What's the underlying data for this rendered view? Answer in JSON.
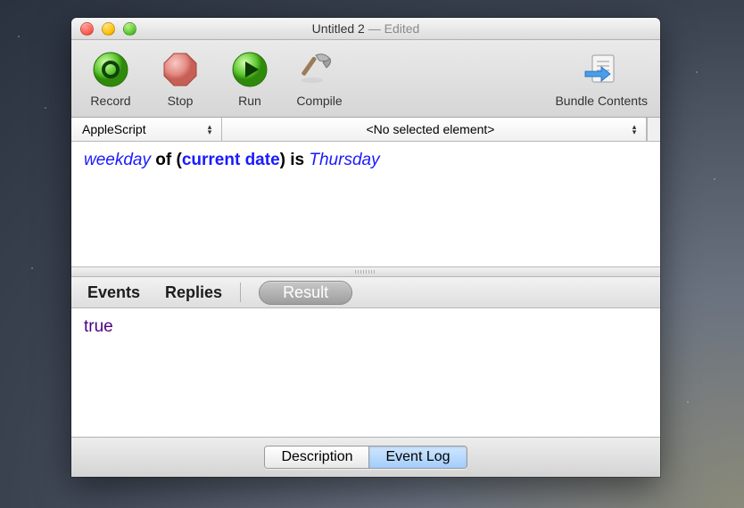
{
  "window": {
    "title_main": "Untitled 2",
    "title_suffix": " — Edited"
  },
  "toolbar": {
    "record_label": "Record",
    "stop_label": "Stop",
    "run_label": "Run",
    "compile_label": "Compile",
    "bundle_label": "Bundle Contents"
  },
  "selectors": {
    "language": "AppleScript",
    "element_placeholder": "<No selected element>"
  },
  "code": {
    "tokens": [
      {
        "text": "weekday",
        "style": "italic-blue"
      },
      {
        "text": " of ",
        "style": "bold"
      },
      {
        "text": "(",
        "style": "bold"
      },
      {
        "text": "current date",
        "style": "bold-blue"
      },
      {
        "text": ")",
        "style": "bold"
      },
      {
        "text": " is ",
        "style": "bold"
      },
      {
        "text": "Thursday",
        "style": "italic-blue"
      }
    ]
  },
  "log_tabs": {
    "events": "Events",
    "replies": "Replies",
    "result": "Result"
  },
  "result_value": "true",
  "bottom_tabs": {
    "description": "Description",
    "event_log": "Event Log"
  }
}
